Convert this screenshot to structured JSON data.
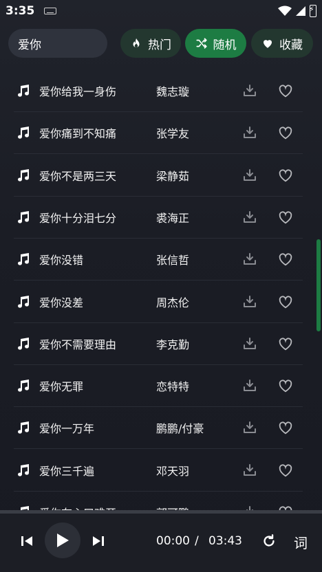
{
  "status": {
    "time": "3:35"
  },
  "search": {
    "value": "爱你",
    "placeholder": ""
  },
  "tabs": [
    {
      "label": "热门",
      "icon": "flame-icon",
      "active": false
    },
    {
      "label": "随机",
      "icon": "shuffle-icon",
      "active": true
    },
    {
      "label": "收藏",
      "icon": "heart-icon",
      "active": false
    }
  ],
  "songs": [
    {
      "title": "爱你给我一身伤",
      "artist": "魏志璇"
    },
    {
      "title": "爱你痛到不知痛",
      "artist": "张学友"
    },
    {
      "title": "爱你不是两三天",
      "artist": "梁静茹"
    },
    {
      "title": "爱你十分泪七分",
      "artist": "裘海正"
    },
    {
      "title": "爱你没错",
      "artist": "张信哲"
    },
    {
      "title": "爱你没差",
      "artist": "周杰伦"
    },
    {
      "title": "爱你不需要理由",
      "artist": "李克勤"
    },
    {
      "title": "爱你无罪",
      "artist": "恋特特"
    },
    {
      "title": "爱你一万年",
      "artist": "鹏鹏/付豪"
    },
    {
      "title": "爱你三千遍",
      "artist": "邓天羽"
    },
    {
      "title": "爱你在心口难开",
      "artist": "郭可鹏"
    }
  ],
  "player": {
    "current_time": "00:00",
    "separator": "/",
    "total_time": "03:43",
    "lyrics_label": "词"
  },
  "colors": {
    "accent": "#1d7c43",
    "pill_bg": "#23372f",
    "background": "#1b1d25"
  }
}
